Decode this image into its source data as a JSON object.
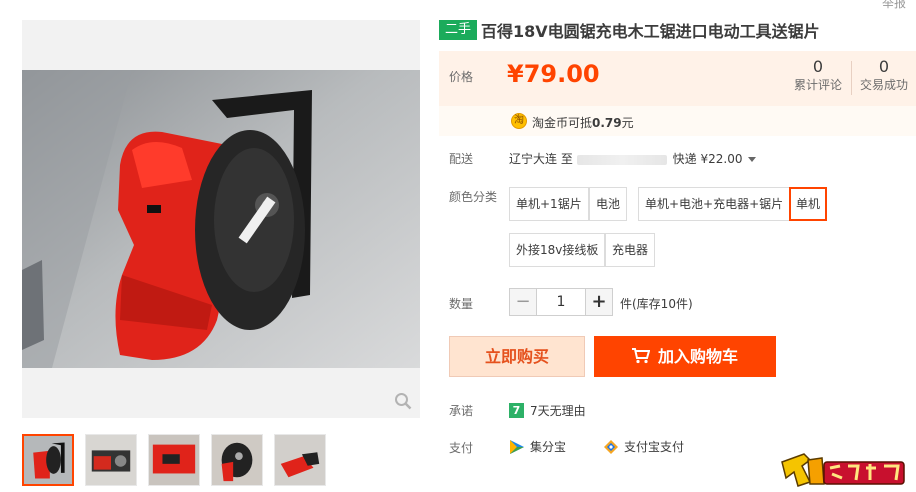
{
  "corner_label": "举报",
  "title": {
    "badge": "二手",
    "text": "百得18V电圆锯充电木工锯进口电动工具送锯片"
  },
  "price": {
    "label": "价格",
    "value": "¥79.00",
    "reviews_count": "0",
    "reviews_label": "累计评论",
    "deals_count": "0",
    "deals_label": "交易成功"
  },
  "coin": {
    "icon": "淘",
    "prefix": "淘金币可抵",
    "amount": "0.79",
    "suffix": "元"
  },
  "shipping": {
    "label": "配送",
    "from": "辽宁大连 至",
    "fee": "快递 ¥22.00"
  },
  "sku": {
    "label": "颜色分类",
    "options": [
      "单机+1锯片",
      "电池",
      "单机+电池+充电器+锯片",
      "单机",
      "外接18v接线板",
      "充电器"
    ],
    "selected": "单机"
  },
  "quantity": {
    "label": "数量",
    "minus": "−",
    "value": "1",
    "plus": "+",
    "stock": "件(库存10件)"
  },
  "actions": {
    "buy_now": "立即购买",
    "add_cart": "加入购物车"
  },
  "promise": {
    "label": "承诺",
    "icon": "7",
    "text": "7天无理由"
  },
  "payment": {
    "label": "支付",
    "methods": [
      "集分宝",
      "支付宝支付"
    ]
  },
  "colors": {
    "accent": "#ff4400",
    "price_bg": "#fff2e8",
    "used_badge": "#1bab5b"
  }
}
